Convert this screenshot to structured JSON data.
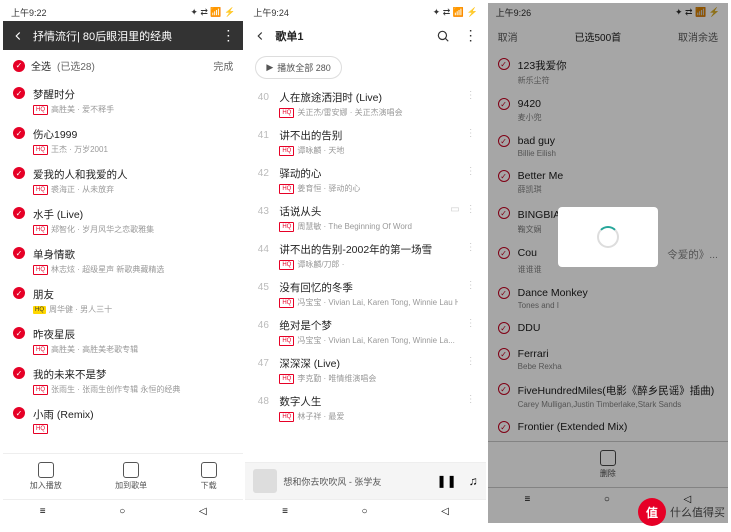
{
  "status": {
    "time1": "上午9:22",
    "time2": "上午9:24",
    "time3": "上午9:26"
  },
  "screen1": {
    "title": "抒情流行| 80后眼泪里的经典",
    "select_all": "全选",
    "selected_count": "(已选28)",
    "done": "完成",
    "songs": [
      {
        "t": "梦醒时分",
        "s": "高胜美 · 爱不释手"
      },
      {
        "t": "伤心1999",
        "s": "王杰 · 万岁2001"
      },
      {
        "t": "爱我的人和我爱的人",
        "s": "裘海正 · 从未放弃"
      },
      {
        "t": "水手 (Live)",
        "s": "郑智化 · 岁月风华之恋歌雅集"
      },
      {
        "t": "单身情歌",
        "s": "林志炫 · 超级星声 新歌典藏精选"
      },
      {
        "t": "朋友",
        "s": "周华健 · 男人三十",
        "y": true
      },
      {
        "t": "昨夜星辰",
        "s": "高胜美 · 高胜美老歌专辑"
      },
      {
        "t": "我的未来不是梦",
        "s": "张雨生 · 张雨生创作专辑 永恒的经典"
      },
      {
        "t": "小雨 (Remix)",
        "s": ""
      }
    ],
    "bottom": {
      "add_play": "加入播放",
      "add_list": "加到歌单",
      "download": "下载"
    }
  },
  "screen2": {
    "title": "歌单1",
    "play_all": "播放全部 280",
    "songs": [
      {
        "n": "40",
        "t": "人在旅途洒泪时 (Live)",
        "s": "关正杰/雷安娜 · 关正杰演唱会"
      },
      {
        "n": "41",
        "t": "讲不出的告别",
        "s": "谭咏麟 · 天地"
      },
      {
        "n": "42",
        "t": "驿动的心",
        "s": "姜育恒 · 驿动的心"
      },
      {
        "n": "43",
        "t": "话说从头",
        "s": "周慧敏 · The Beginning Of Word",
        "mv": true
      },
      {
        "n": "44",
        "t": "讲不出的告别-2002年的第一场雪",
        "s": "谭咏麟/刀郎 · "
      },
      {
        "n": "45",
        "t": "没有回忆的冬季",
        "s": "冯宝宝 · Vivian Lai, Karen Tong, Winnie Lau H..."
      },
      {
        "n": "46",
        "t": "绝对是个梦",
        "s": "冯宝宝 · Vivian Lai, Karen Tong, Winnie La..."
      },
      {
        "n": "47",
        "t": "深深深 (Live)",
        "s": "李克勤 · 唯情维演唱会"
      },
      {
        "n": "48",
        "t": "数字人生",
        "s": "林子祥 · 最爱"
      }
    ],
    "now_playing": "想和你去吹吹风 - 张学友"
  },
  "screen3": {
    "cancel": "取消",
    "title": "已选500首",
    "cancel_all": "取消余选",
    "songs": [
      {
        "t": "123我爱你",
        "s": "新乐尘符"
      },
      {
        "t": "9420",
        "s": "麦小兜"
      },
      {
        "t": "bad guy",
        "s": "Billie Eilish"
      },
      {
        "t": "Better Me",
        "s": "薛凯琪"
      },
      {
        "t": "BINGBIAN病变(女生版)",
        "s": "鞠文娴"
      },
      {
        "t": "Cou",
        "s": "谁谁谁",
        "ext": "令爱的》..."
      },
      {
        "t": "Dance Monkey",
        "s": "Tones and I"
      },
      {
        "t": "DDU",
        "s": ""
      },
      {
        "t": "Ferrari",
        "s": "Bebe Rexha"
      },
      {
        "t": "FiveHundredMiles(电影《醉乡民谣》插曲)",
        "s": "Carey Mulligan,Justin Timberlake,Stark Sands"
      },
      {
        "t": "Frontier (Extended Mix)",
        "s": ""
      }
    ],
    "bottom": "删除"
  },
  "watermark": {
    "badge": "值",
    "text": "什么值得买"
  }
}
